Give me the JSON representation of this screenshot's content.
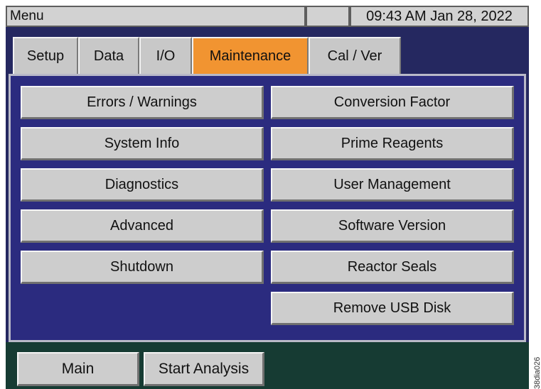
{
  "title_bar": {
    "menu_label": "Menu",
    "clock": "09:43 AM Jan 28, 2022"
  },
  "tabs": [
    {
      "label": "Setup",
      "active": false
    },
    {
      "label": "Data",
      "active": false
    },
    {
      "label": "I/O",
      "active": false
    },
    {
      "label": "Maintenance",
      "active": true
    },
    {
      "label": "Cal / Ver",
      "active": false
    }
  ],
  "maintenance": {
    "left_buttons": [
      {
        "label": "Errors / Warnings"
      },
      {
        "label": "System Info"
      },
      {
        "label": "Diagnostics"
      },
      {
        "label": "Advanced"
      },
      {
        "label": "Shutdown"
      }
    ],
    "right_buttons": [
      {
        "label": "Conversion Factor"
      },
      {
        "label": "Prime Reagents"
      },
      {
        "label": "User Management"
      },
      {
        "label": "Software Version"
      },
      {
        "label": "Reactor Seals"
      },
      {
        "label": "Remove USB Disk"
      }
    ]
  },
  "bottom_bar": {
    "main_label": "Main",
    "start_analysis_label": "Start Analysis"
  },
  "side_code": "38dia026",
  "colors": {
    "active_tab": "#f19431",
    "panel_background": "#2b2b7f",
    "bottom_bar": "#163b33"
  }
}
